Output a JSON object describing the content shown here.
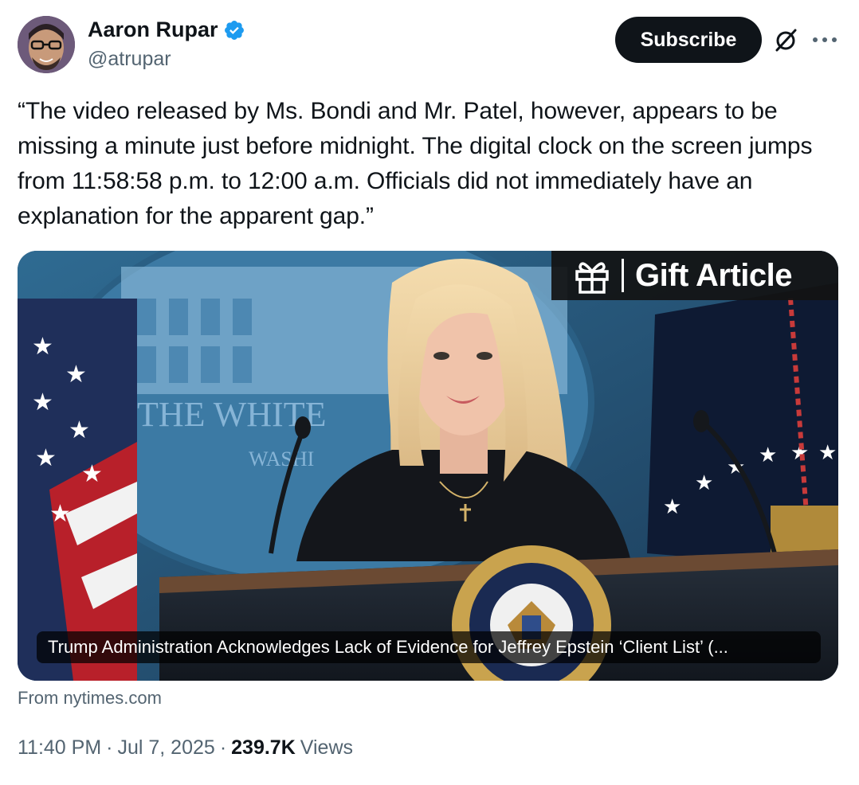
{
  "author": {
    "name": "Aaron Rupar",
    "handle": "@atrupar",
    "verified": true
  },
  "header": {
    "subscribe_label": "Subscribe"
  },
  "icons": {
    "verified": "verified-badge-icon",
    "grok": "grok-icon",
    "more": "more-icon",
    "gift": "gift-icon"
  },
  "tweet": {
    "text": "“The video released by Ms. Bondi and Mr. Patel, however, appears to be missing a minute just before midnight. The digital clock on the screen jumps from 11:58:58 p.m. to 12:00 a.m. Officials did not immediately have an explanation for the apparent gap.”"
  },
  "media": {
    "gift_label": "Gift Article",
    "caption": "Trump Administration Acknowledges Lack of Evidence for Jeffrey Epstein ‘Client List’ (...",
    "podium_seal_text": "PRESIDENT OF THE UNITED STATES",
    "background_text_line1": "THE WHITE",
    "background_text_line2": "WASHI"
  },
  "source": {
    "label": "From nytimes.com"
  },
  "meta": {
    "time": "11:40 PM",
    "date": "Jul 7, 2025",
    "separator": "·",
    "views_count": "239.7K",
    "views_label": "Views"
  },
  "colors": {
    "text_primary": "#0f1419",
    "text_secondary": "#536471",
    "verified_blue": "#1d9bf0",
    "button_dark": "#0f1419"
  }
}
